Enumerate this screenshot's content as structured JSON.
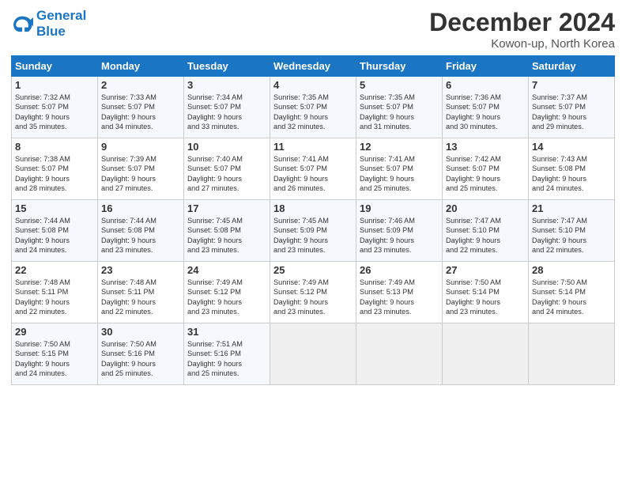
{
  "logo": {
    "line1": "General",
    "line2": "Blue"
  },
  "title": "December 2024",
  "subtitle": "Kowon-up, North Korea",
  "weekdays": [
    "Sunday",
    "Monday",
    "Tuesday",
    "Wednesday",
    "Thursday",
    "Friday",
    "Saturday"
  ],
  "weeks": [
    [
      {
        "day": "1",
        "lines": [
          "Sunrise: 7:32 AM",
          "Sunset: 5:07 PM",
          "Daylight: 9 hours",
          "and 35 minutes."
        ]
      },
      {
        "day": "2",
        "lines": [
          "Sunrise: 7:33 AM",
          "Sunset: 5:07 PM",
          "Daylight: 9 hours",
          "and 34 minutes."
        ]
      },
      {
        "day": "3",
        "lines": [
          "Sunrise: 7:34 AM",
          "Sunset: 5:07 PM",
          "Daylight: 9 hours",
          "and 33 minutes."
        ]
      },
      {
        "day": "4",
        "lines": [
          "Sunrise: 7:35 AM",
          "Sunset: 5:07 PM",
          "Daylight: 9 hours",
          "and 32 minutes."
        ]
      },
      {
        "day": "5",
        "lines": [
          "Sunrise: 7:35 AM",
          "Sunset: 5:07 PM",
          "Daylight: 9 hours",
          "and 31 minutes."
        ]
      },
      {
        "day": "6",
        "lines": [
          "Sunrise: 7:36 AM",
          "Sunset: 5:07 PM",
          "Daylight: 9 hours",
          "and 30 minutes."
        ]
      },
      {
        "day": "7",
        "lines": [
          "Sunrise: 7:37 AM",
          "Sunset: 5:07 PM",
          "Daylight: 9 hours",
          "and 29 minutes."
        ]
      }
    ],
    [
      {
        "day": "8",
        "lines": [
          "Sunrise: 7:38 AM",
          "Sunset: 5:07 PM",
          "Daylight: 9 hours",
          "and 28 minutes."
        ]
      },
      {
        "day": "9",
        "lines": [
          "Sunrise: 7:39 AM",
          "Sunset: 5:07 PM",
          "Daylight: 9 hours",
          "and 27 minutes."
        ]
      },
      {
        "day": "10",
        "lines": [
          "Sunrise: 7:40 AM",
          "Sunset: 5:07 PM",
          "Daylight: 9 hours",
          "and 27 minutes."
        ]
      },
      {
        "day": "11",
        "lines": [
          "Sunrise: 7:41 AM",
          "Sunset: 5:07 PM",
          "Daylight: 9 hours",
          "and 26 minutes."
        ]
      },
      {
        "day": "12",
        "lines": [
          "Sunrise: 7:41 AM",
          "Sunset: 5:07 PM",
          "Daylight: 9 hours",
          "and 25 minutes."
        ]
      },
      {
        "day": "13",
        "lines": [
          "Sunrise: 7:42 AM",
          "Sunset: 5:07 PM",
          "Daylight: 9 hours",
          "and 25 minutes."
        ]
      },
      {
        "day": "14",
        "lines": [
          "Sunrise: 7:43 AM",
          "Sunset: 5:08 PM",
          "Daylight: 9 hours",
          "and 24 minutes."
        ]
      }
    ],
    [
      {
        "day": "15",
        "lines": [
          "Sunrise: 7:44 AM",
          "Sunset: 5:08 PM",
          "Daylight: 9 hours",
          "and 24 minutes."
        ]
      },
      {
        "day": "16",
        "lines": [
          "Sunrise: 7:44 AM",
          "Sunset: 5:08 PM",
          "Daylight: 9 hours",
          "and 23 minutes."
        ]
      },
      {
        "day": "17",
        "lines": [
          "Sunrise: 7:45 AM",
          "Sunset: 5:08 PM",
          "Daylight: 9 hours",
          "and 23 minutes."
        ]
      },
      {
        "day": "18",
        "lines": [
          "Sunrise: 7:45 AM",
          "Sunset: 5:09 PM",
          "Daylight: 9 hours",
          "and 23 minutes."
        ]
      },
      {
        "day": "19",
        "lines": [
          "Sunrise: 7:46 AM",
          "Sunset: 5:09 PM",
          "Daylight: 9 hours",
          "and 23 minutes."
        ]
      },
      {
        "day": "20",
        "lines": [
          "Sunrise: 7:47 AM",
          "Sunset: 5:10 PM",
          "Daylight: 9 hours",
          "and 22 minutes."
        ]
      },
      {
        "day": "21",
        "lines": [
          "Sunrise: 7:47 AM",
          "Sunset: 5:10 PM",
          "Daylight: 9 hours",
          "and 22 minutes."
        ]
      }
    ],
    [
      {
        "day": "22",
        "lines": [
          "Sunrise: 7:48 AM",
          "Sunset: 5:11 PM",
          "Daylight: 9 hours",
          "and 22 minutes."
        ]
      },
      {
        "day": "23",
        "lines": [
          "Sunrise: 7:48 AM",
          "Sunset: 5:11 PM",
          "Daylight: 9 hours",
          "and 22 minutes."
        ]
      },
      {
        "day": "24",
        "lines": [
          "Sunrise: 7:49 AM",
          "Sunset: 5:12 PM",
          "Daylight: 9 hours",
          "and 23 minutes."
        ]
      },
      {
        "day": "25",
        "lines": [
          "Sunrise: 7:49 AM",
          "Sunset: 5:12 PM",
          "Daylight: 9 hours",
          "and 23 minutes."
        ]
      },
      {
        "day": "26",
        "lines": [
          "Sunrise: 7:49 AM",
          "Sunset: 5:13 PM",
          "Daylight: 9 hours",
          "and 23 minutes."
        ]
      },
      {
        "day": "27",
        "lines": [
          "Sunrise: 7:50 AM",
          "Sunset: 5:14 PM",
          "Daylight: 9 hours",
          "and 23 minutes."
        ]
      },
      {
        "day": "28",
        "lines": [
          "Sunrise: 7:50 AM",
          "Sunset: 5:14 PM",
          "Daylight: 9 hours",
          "and 24 minutes."
        ]
      }
    ],
    [
      {
        "day": "29",
        "lines": [
          "Sunrise: 7:50 AM",
          "Sunset: 5:15 PM",
          "Daylight: 9 hours",
          "and 24 minutes."
        ]
      },
      {
        "day": "30",
        "lines": [
          "Sunrise: 7:50 AM",
          "Sunset: 5:16 PM",
          "Daylight: 9 hours",
          "and 25 minutes."
        ]
      },
      {
        "day": "31",
        "lines": [
          "Sunrise: 7:51 AM",
          "Sunset: 5:16 PM",
          "Daylight: 9 hours",
          "and 25 minutes."
        ]
      },
      null,
      null,
      null,
      null
    ]
  ]
}
